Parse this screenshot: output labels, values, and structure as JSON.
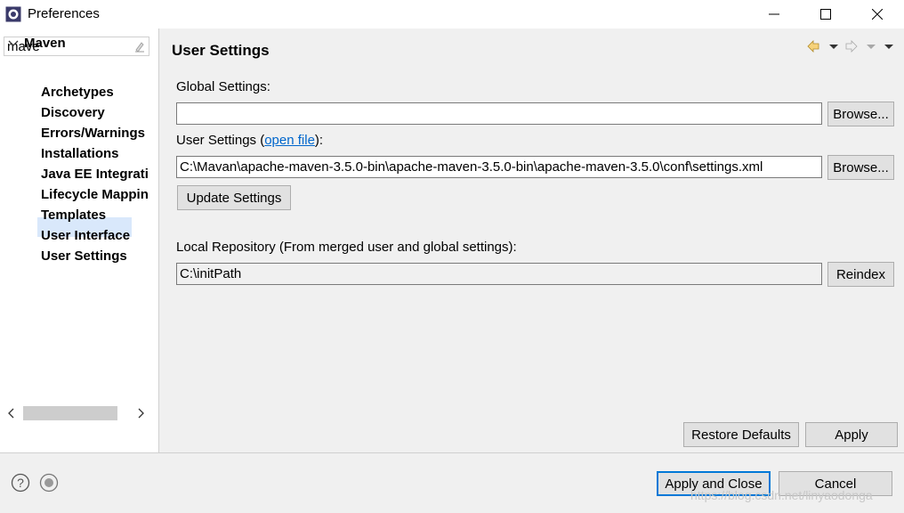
{
  "window": {
    "title": "Preferences",
    "minimize_icon": "minimize-icon",
    "maximize_icon": "maximize-icon",
    "close_icon": "close-icon"
  },
  "sidebar": {
    "filter_value": "mave",
    "tree": {
      "root": "Maven",
      "children": [
        "Archetypes",
        "Discovery",
        "Errors/Warnings",
        "Installations",
        "Java EE Integrati",
        "Lifecycle Mappin",
        "Templates",
        "User Interface",
        "User Settings"
      ],
      "selected": "User Settings"
    }
  },
  "page": {
    "title": "User Settings",
    "global_settings_label": "Global Settings:",
    "global_settings_value": "",
    "global_browse_label": "Browse...",
    "user_settings_label_prefix": "User Settings (",
    "user_settings_link": "open file",
    "user_settings_label_suffix": "):",
    "user_settings_value": "C:\\Mavan\\apache-maven-3.5.0-bin\\apache-maven-3.5.0-bin\\apache-maven-3.5.0\\conf\\settings.xml",
    "user_browse_label": "Browse...",
    "update_settings_label": "Update Settings",
    "local_repo_label": "Local Repository (From merged user and global settings):",
    "local_repo_value": "C:\\initPath",
    "reindex_label": "Reindex",
    "restore_defaults_label": "Restore Defaults",
    "apply_label": "Apply"
  },
  "footer": {
    "apply_close_label": "Apply and Close",
    "cancel_label": "Cancel",
    "watermark": "https://blog.csdn.net/linyaodonga"
  },
  "colors": {
    "selection": "#d9e8fb",
    "link": "#0066cc",
    "default_button_border": "#0078d7"
  }
}
